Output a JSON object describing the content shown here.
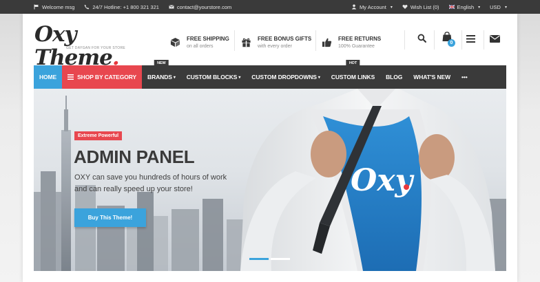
{
  "topbar": {
    "welcome": "Welcome msg",
    "hotline": "24/7 Hotline: +1 800 321 321",
    "email": "contact@yourstore.com",
    "account": "My Account",
    "wishlist": "Wish List (0)",
    "language": "English",
    "currency": "USD"
  },
  "header": {
    "logo_text": "Oxy Theme",
    "logo_dot": ".",
    "logo_tagline": "GET DAYGAN FOR YOUR STORE",
    "features": [
      {
        "title": "FREE SHIPPING",
        "subtitle": "on all orders",
        "icon": "box-icon"
      },
      {
        "title": "FREE BONUS GIFTS",
        "subtitle": "with every order",
        "icon": "gift-icon"
      },
      {
        "title": "FREE RETURNS",
        "subtitle": "100% Guarantee",
        "icon": "thumbs-up-icon"
      }
    ],
    "cart_count": "0"
  },
  "nav": {
    "home": "HOME",
    "shop_by_category": "SHOP BY CATEGORY",
    "brands": "BRANDS",
    "brands_badge": "NEW",
    "custom_blocks": "CUSTOM BLOCKS",
    "custom_dropdowns": "CUSTOM DROPDOWNS",
    "custom_links": "CUSTOM LINKS",
    "custom_links_badge": "HOT",
    "blog": "BLOG",
    "whats_new": "WHAT'S NEW",
    "more": "•••"
  },
  "hero": {
    "badge": "Extreme Powerful",
    "title": "ADMIN PANEL",
    "text": "OXY can save you hundreds of hours of work and can really speed up your store!",
    "button": "Buy This Theme!",
    "shirt_logo": "Oxy",
    "slides_total": 2,
    "slide_active": 1
  },
  "colors": {
    "accent_blue": "#3ba3dc",
    "accent_red": "#e8474f",
    "dark": "#3a3a3a"
  }
}
